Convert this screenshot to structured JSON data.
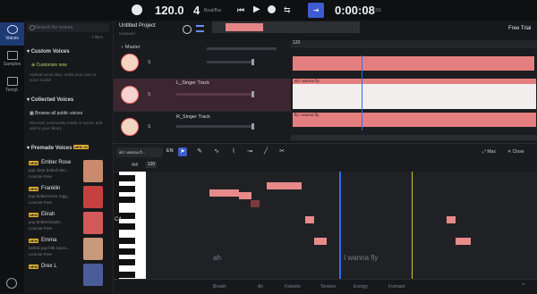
{
  "topbar": {
    "tempo": "120.0",
    "beats": "4",
    "beats_unit": "Beat/Bar",
    "time": "0:00:08",
    "time_total": "2:50",
    "free_trial": "Free Trial"
  },
  "rail": {
    "items": [
      {
        "label": "Voices",
        "icon": "voices-icon"
      },
      {
        "label": "Samples",
        "icon": "samples-icon"
      },
      {
        "label": "Templ.",
        "icon": "templates-icon"
      }
    ],
    "settings_icon": "gear-icon"
  },
  "voices": {
    "search_placeholder": "Search for voices",
    "filters_label": "Filters",
    "custom": {
      "title": "Custom Voices",
      "link": "Customize now",
      "sub": "Upload vocal data, make your own AI voice model"
    },
    "collected": {
      "title": "Collected Voices",
      "link": "Browse all public voices",
      "sub": "Discover community-made AI voices and add to your library"
    },
    "premade": {
      "title": "Premade Voices",
      "count": "20",
      "badge": "NEW 20",
      "items": [
        {
          "name": "Ember Rose",
          "desc": "pop clear belted elec...",
          "tag": "License Free",
          "color": "#c98a6e"
        },
        {
          "name": "Franklin",
          "desc": "pop belted tenor regg...",
          "tag": "License Free",
          "color": "#c74040"
        },
        {
          "name": "Elirah",
          "desc": "pop belted breath...",
          "tag": "License Free",
          "color": "#d45a5a"
        },
        {
          "name": "Emma",
          "desc": "belted pop folk sopra...",
          "tag": "License Free",
          "color": "#c99a7a"
        },
        {
          "name": "Drex L",
          "desc": "",
          "tag": "",
          "color": "#4a5c9a"
        }
      ]
    }
  },
  "project": {
    "title": "Untitled Project",
    "status": "Unsaved"
  },
  "tracks": {
    "master": "Master",
    "items": [
      {
        "name": "",
        "solo": "S",
        "selected": false
      },
      {
        "name": "L_Singer Track",
        "solo": "S",
        "selected": true
      },
      {
        "name": "R_Singer Track",
        "solo": "S",
        "selected": false
      }
    ],
    "ruler_marker": "120",
    "ruler_sig": "4/"
  },
  "clips": {
    "l_label": "ah I wanna fly",
    "r_label": "fly I wanna fly"
  },
  "editor": {
    "lyric_preview": "ah I wanna fl...",
    "language": "EN",
    "max_label": "Max",
    "close_label": "Close",
    "ruler_marker": "120",
    "ruler_sig": "4/4",
    "key_label": "C4",
    "tools": [
      "pointer-icon",
      "pencil-icon",
      "vibrato-icon",
      "pitch-icon",
      "curve-icon",
      "line-icon",
      "split-icon"
    ]
  },
  "roll": {
    "lyrics": [
      {
        "text": "ah"
      },
      {
        "text": "I wanna fly"
      }
    ]
  },
  "params": [
    "Breath",
    "Air",
    "Falsetto",
    "Tension",
    "Energy",
    "Formant"
  ]
}
